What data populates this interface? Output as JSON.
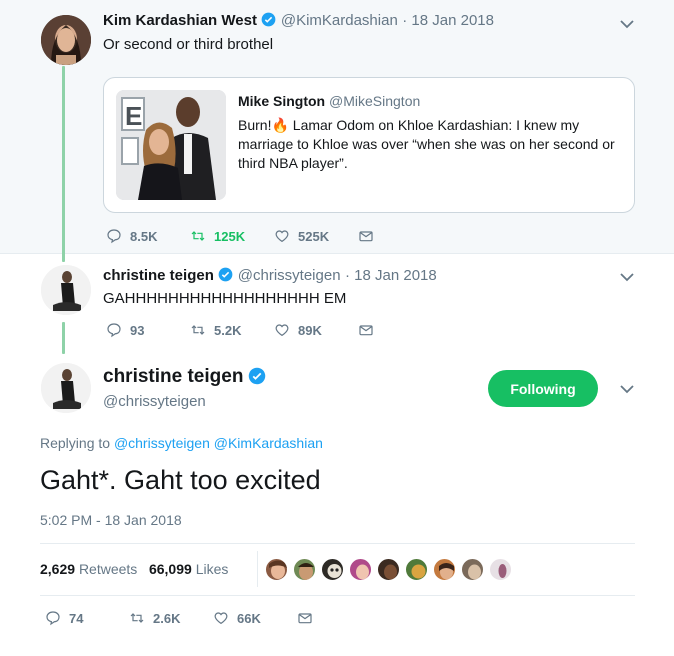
{
  "tweet1": {
    "name": "Kim Kardashian West",
    "handle": "@KimKardashian",
    "date": "· 18 Jan 2018",
    "text": "Or second or third brothel",
    "quote": {
      "name": "Mike Sington",
      "handle": "@MikeSington",
      "text": "Burn!🔥 Lamar Odom on Khloe Kardashian: I knew my marriage to Khloe was over “when she was on her second or third NBA player”."
    },
    "actions": {
      "replies": "8.5K",
      "retweets": "125K",
      "likes": "525K"
    }
  },
  "tweet2": {
    "name": "christine teigen",
    "handle": "@chrissyteigen",
    "date": "· 18 Jan 2018",
    "text": "GAHHHHHHHHHHHHHHHHHH EM",
    "actions": {
      "replies": "93",
      "retweets": "5.2K",
      "likes": "89K"
    }
  },
  "tweet3": {
    "name": "christine teigen",
    "handle": "@chrissyteigen",
    "follow_label": "Following",
    "replying_prefix": "Replying to",
    "replying_to_1": "@chrissyteigen",
    "replying_to_2": "@KimKardashian",
    "text": "Gaht*. Gaht too excited",
    "timestamp": "5:02 PM - 18 Jan 2018",
    "retweets_count": "2,629",
    "retweets_label": "Retweets",
    "likes_count": "66,099",
    "likes_label": "Likes",
    "actions": {
      "replies": "74",
      "retweets": "2.6K",
      "likes": "66K"
    }
  },
  "colors": {
    "accent": "#1da1f2",
    "retweet_green": "#17bf63",
    "thread_line": "#8ed2a8",
    "muted": "#657786"
  }
}
